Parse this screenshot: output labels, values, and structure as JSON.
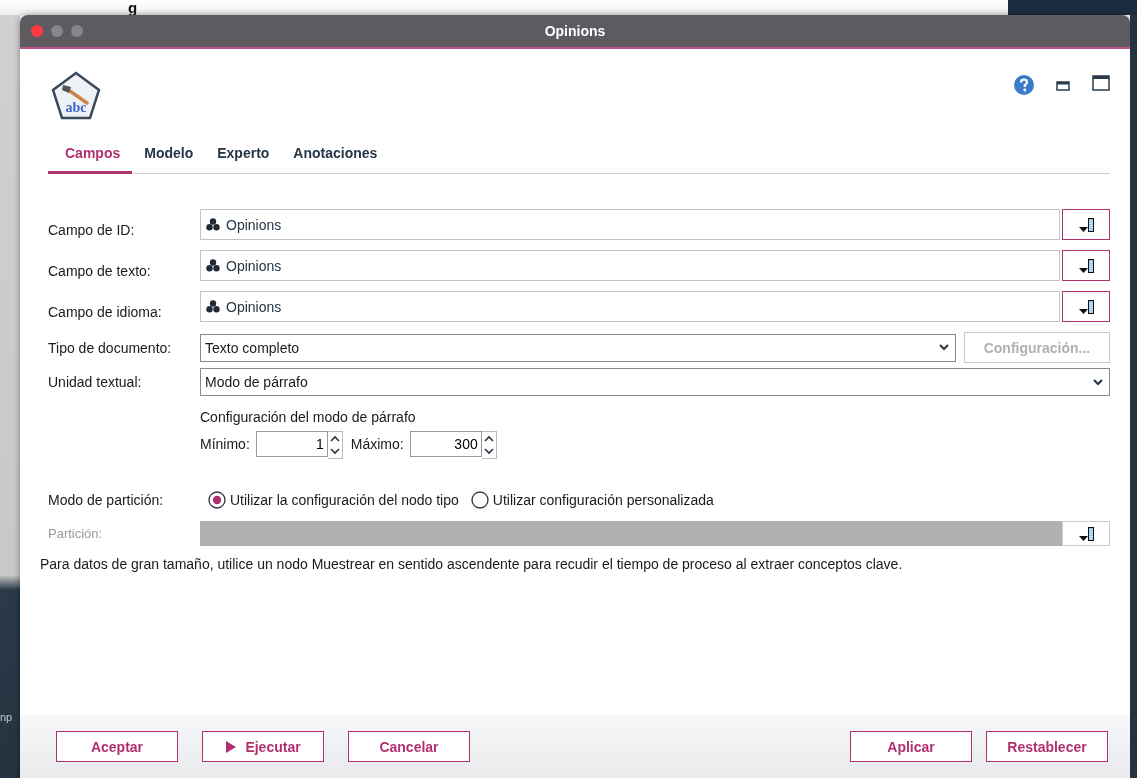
{
  "background": {
    "top_text": "g",
    "side_text": "np"
  },
  "window": {
    "title": "Opinions",
    "logo_text": "abc"
  },
  "tabs": [
    {
      "label": "Campos",
      "selected": true
    },
    {
      "label": "Modelo",
      "selected": false
    },
    {
      "label": "Experto",
      "selected": false
    },
    {
      "label": "Anotaciones",
      "selected": false
    }
  ],
  "fields": [
    {
      "kind": "picker",
      "label": "Campo de ID:",
      "value": "Opinions"
    },
    {
      "kind": "picker",
      "label": "Campo de texto:",
      "value": "Opinions"
    },
    {
      "kind": "picker",
      "label": "Campo de idioma:",
      "value": "Opinions"
    },
    {
      "kind": "dropdown",
      "label": "Tipo de documento:",
      "value": "Texto completo",
      "button": {
        "label": "Configuración...",
        "disabled": true
      }
    },
    {
      "kind": "dropdown",
      "label": "Unidad textual:",
      "value": "Modo de párrafo"
    }
  ],
  "paragraph_settings": {
    "title": "Configuración del modo de párrafo",
    "spinners": [
      {
        "label": "Mínimo:",
        "value": "1"
      },
      {
        "label": "Máximo:",
        "value": "300"
      }
    ]
  },
  "partition_mode": {
    "label": "Modo de partición:",
    "options": [
      {
        "label": "Utilizar la configuración del nodo tipo",
        "selected": true
      },
      {
        "label": "Utilizar configuración personalizada",
        "selected": false
      }
    ]
  },
  "partition": {
    "label": "Partición:",
    "disabled": true
  },
  "note": "Para datos de gran tamaño, utilice un nodo Muestrear en sentido ascendente para recudir el tiempo de proceso al extraer conceptos clave.",
  "buttons_left": [
    {
      "label": "Aceptar",
      "kind": "plain"
    },
    {
      "label": "Ejecutar",
      "kind": "run"
    },
    {
      "label": "Cancelar",
      "kind": "plain"
    }
  ],
  "buttons_right": [
    {
      "label": "Aplicar",
      "kind": "plain"
    },
    {
      "label": "Restablecer",
      "kind": "plain"
    }
  ]
}
